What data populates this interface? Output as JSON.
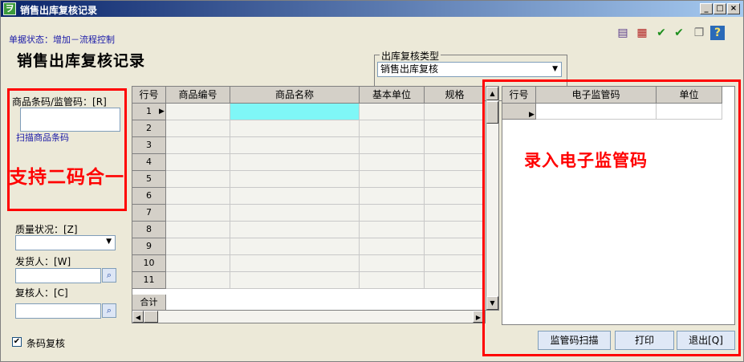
{
  "window": {
    "title": "销售出库复核记录",
    "app_icon": "leaf-icon"
  },
  "status_line": "单据状态：增加－流程控制",
  "page_title": "销售出库复核记录",
  "toolbar": {
    "icons": [
      "document-icon",
      "grid-delete-icon",
      "check-icon",
      "double-check-icon",
      "copy-icon",
      "help-icon"
    ]
  },
  "type_group": {
    "label": "出库复核类型",
    "value": "销售出库复核"
  },
  "left_panel": {
    "barcode_label": "商品条码/监管码：[R]",
    "barcode_value": "",
    "scan_link": "扫描商品条码",
    "quality_label": "质量状况：[Z]",
    "quality_value": "",
    "shipper_label": "发货人：[W]",
    "shipper_value": "",
    "reviewer_label": "复核人：[C]",
    "reviewer_value": ""
  },
  "annotations": {
    "left": "支持二码合一",
    "right": "录入电子监管码",
    "color": "#ff0000"
  },
  "main_grid": {
    "columns": [
      "行号",
      "商品编号",
      "商品名称",
      "基本单位",
      "规格"
    ],
    "rows": [
      "1",
      "2",
      "3",
      "4",
      "5",
      "6",
      "7",
      "8",
      "9",
      "10",
      "11"
    ],
    "total_label": "合计",
    "selected_color": "#7ff7f7"
  },
  "right_grid": {
    "columns": [
      "行号",
      "电子监管码",
      "单位"
    ]
  },
  "buttons": {
    "scan": "监管码扫描",
    "print": "打印",
    "exit": "退出[Q]"
  },
  "checkbox": {
    "label": "条码复核",
    "checked": true
  }
}
